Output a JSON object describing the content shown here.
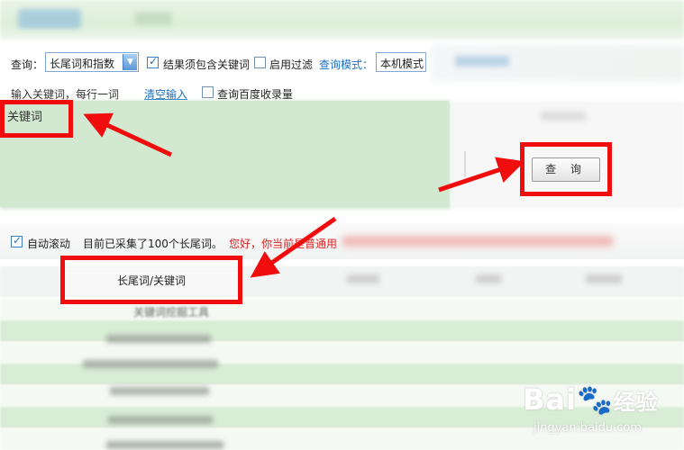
{
  "toolbar": {
    "query_label": "查询：",
    "query_type_value": "长尾词和指数",
    "must_contain_label": "结果须包含关键词",
    "must_contain_checked": true,
    "enable_filter_label": "启用过滤",
    "enable_filter_checked": false,
    "query_mode_label": "查询模式：",
    "query_mode_value": "本机模式"
  },
  "input_row": {
    "instruction": "输入关键词，每行一词",
    "clear_link": "清空输入",
    "baidu_index_label": "查询百度收录量",
    "baidu_index_checked": false
  },
  "keyword_input": {
    "value": "关键词"
  },
  "query_button": {
    "label": "查 询"
  },
  "status": {
    "auto_scroll_label": "自动滚动",
    "auto_scroll_checked": true,
    "collected_text": "目前已采集了100个长尾词。",
    "notice_text": "您好，你当前是普通用户"
  },
  "table": {
    "header_main": "长尾词/关键词",
    "first_row": "关键词挖掘工具"
  },
  "watermark": {
    "brand": "Bai",
    "brand_cn": "经验",
    "url": "jingyan.baidu.com"
  },
  "colors": {
    "highlight_red": "#f00d0d",
    "link_blue": "#1a6fc0",
    "input_green": "#d2e8d0",
    "notice_red": "#e02020"
  }
}
